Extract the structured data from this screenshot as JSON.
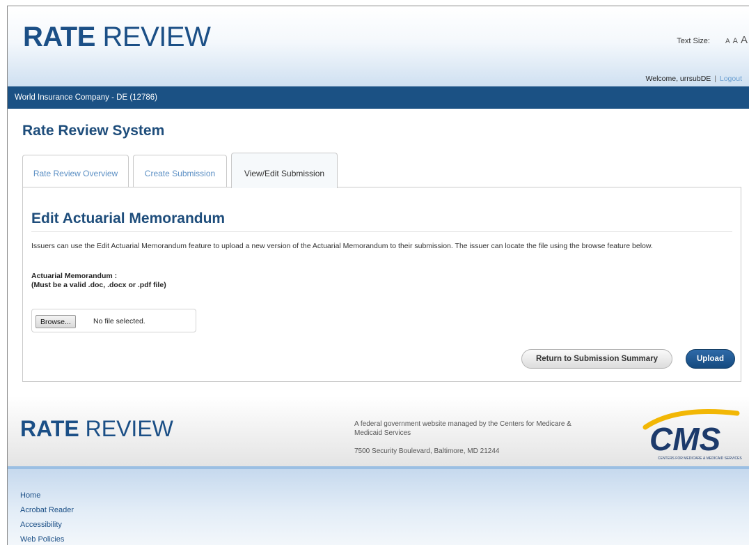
{
  "header": {
    "logo_bold": "RATE",
    "logo_light": "REVIEW",
    "text_size_label": "Text Size:",
    "text_size_small": "A",
    "text_size_medium": "A",
    "text_size_large": "A",
    "welcome_text": "Welcome, urrsubDE",
    "separator": "|",
    "logout_label": "Logout"
  },
  "company_bar": {
    "text": "World Insurance Company - DE (12786)"
  },
  "system_title": "Rate Review System",
  "tabs": [
    {
      "label": "Rate Review Overview",
      "active": false
    },
    {
      "label": "Create Submission",
      "active": false
    },
    {
      "label": "View/Edit Submission",
      "active": true
    }
  ],
  "panel": {
    "title": "Edit Actuarial Memorandum",
    "description": "Issuers can use the Edit Actuarial Memorandum feature to upload a new version of the Actuarial Memorandum to their submission. The issuer can locate the file using the browse feature below.",
    "field_label": "Actuarial Memorandum :",
    "field_hint": "(Must be a valid .doc, .docx or .pdf file)",
    "browse_label": "Browse...",
    "file_status": "No file selected.",
    "return_button": "Return to Submission Summary",
    "upload_button": "Upload"
  },
  "footer": {
    "logo_bold": "RATE",
    "logo_light": "REVIEW",
    "description": "A federal government website managed by the Centers for Medicare & Medicaid Services",
    "address": "7500 Security Boulevard, Baltimore, MD 21244",
    "cms_logo_text": "CMS",
    "cms_logo_subtext": "CENTERS FOR MEDICARE & MEDICAID SERVICES",
    "links": [
      "Home",
      "Acrobat Reader",
      "Accessibility",
      "Web Policies"
    ]
  },
  "colors": {
    "brand_blue": "#1b5184",
    "title_blue": "#1e4d7b",
    "link_blue": "#5b8fc4",
    "cms_gold": "#f2b705"
  }
}
